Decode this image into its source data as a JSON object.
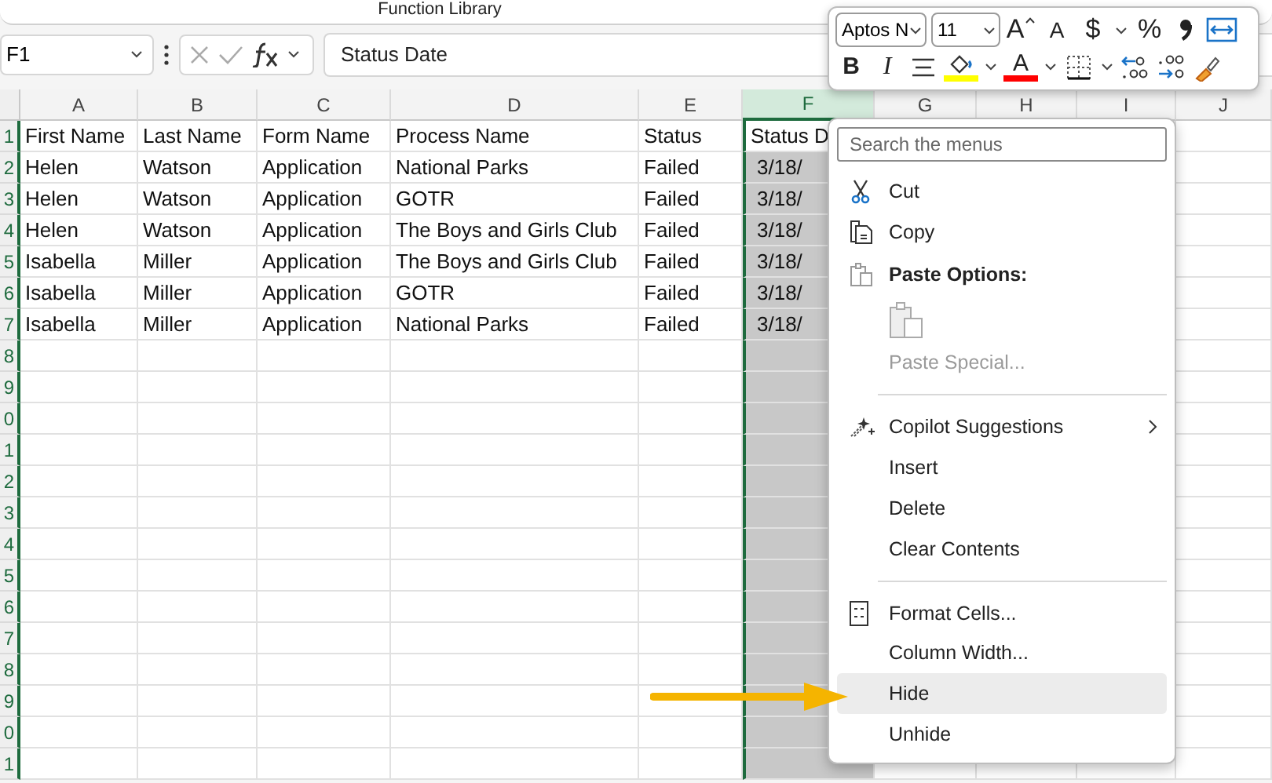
{
  "ribbon": {
    "group_label": "Function Library"
  },
  "formula_bar": {
    "name_box": "F1",
    "value": "Status Date"
  },
  "columns": [
    {
      "label": "A",
      "selected": false
    },
    {
      "label": "B",
      "selected": false
    },
    {
      "label": "C",
      "selected": false
    },
    {
      "label": "D",
      "selected": false
    },
    {
      "label": "E",
      "selected": false
    },
    {
      "label": "F",
      "selected": true
    },
    {
      "label": "G",
      "selected": false
    },
    {
      "label": "H",
      "selected": false
    },
    {
      "label": "I",
      "selected": false
    },
    {
      "label": "J",
      "selected": false
    }
  ],
  "rows": [
    {
      "number": "1",
      "cells": [
        "First Name",
        "Last Name",
        "Form Name",
        "Process Name",
        "Status",
        "Status D"
      ]
    },
    {
      "number": "2",
      "cells": [
        "Helen",
        "Watson",
        "Application",
        "National Parks",
        "Failed",
        "3/18/"
      ]
    },
    {
      "number": "3",
      "cells": [
        "Helen",
        "Watson",
        "Application",
        "GOTR",
        "Failed",
        "3/18/"
      ]
    },
    {
      "number": "4",
      "cells": [
        "Helen",
        "Watson",
        "Application",
        "The Boys and Girls Club",
        "Failed",
        "3/18/"
      ]
    },
    {
      "number": "5",
      "cells": [
        "Isabella",
        "Miller",
        "Application",
        "The Boys and Girls Club",
        "Failed",
        "3/18/"
      ]
    },
    {
      "number": "6",
      "cells": [
        "Isabella",
        "Miller",
        "Application",
        "GOTR",
        "Failed",
        "3/18/"
      ]
    },
    {
      "number": "7",
      "cells": [
        "Isabella",
        "Miller",
        "Application",
        "National Parks",
        "Failed",
        "3/18/"
      ]
    },
    {
      "number": "8"
    },
    {
      "number": "9"
    },
    {
      "number": "0"
    },
    {
      "number": "1"
    },
    {
      "number": "2"
    },
    {
      "number": "3"
    },
    {
      "number": "4"
    },
    {
      "number": "5"
    },
    {
      "number": "6"
    },
    {
      "number": "7"
    },
    {
      "number": "8"
    },
    {
      "number": "9"
    },
    {
      "number": "0"
    },
    {
      "number": "1"
    }
  ],
  "mini_toolbar": {
    "font": "Aptos N",
    "size": "11",
    "row_1": [
      {
        "kind": "grow",
        "text": "A"
      },
      {
        "kind": "shrink",
        "text": "A"
      },
      {
        "kind": "letter",
        "text": "$"
      },
      {
        "kind": "caret"
      },
      {
        "kind": "letter",
        "text": "%"
      },
      {
        "kind": "comma"
      },
      {
        "kind": "wrap"
      }
    ],
    "row_2": [
      {
        "kind": "bold",
        "text": "B"
      },
      {
        "kind": "italic",
        "text": "I"
      },
      {
        "kind": "align"
      },
      {
        "kind": "fill",
        "color": "#ffff00"
      },
      {
        "kind": "caret"
      },
      {
        "kind": "fontcolor",
        "text": "A",
        "color": "#ff0000"
      },
      {
        "kind": "caret"
      },
      {
        "kind": "borders"
      },
      {
        "kind": "caret"
      },
      {
        "kind": "decdec"
      },
      {
        "kind": "incdec"
      },
      {
        "kind": "painter"
      }
    ]
  },
  "context_menu": {
    "search_placeholder": "Search the menus",
    "items": [
      {
        "kind": "cut",
        "label": "Cut",
        "selected": false,
        "disabled": false
      },
      {
        "kind": "copy",
        "label": "Copy",
        "selected": false,
        "disabled": false
      },
      {
        "kind": "header",
        "label": "Paste Options:"
      },
      {
        "kind": "paste",
        "disabled": true
      },
      {
        "kind": "command",
        "label": "Paste Special...",
        "selected": false,
        "disabled": true
      },
      {
        "kind": "separator"
      },
      {
        "kind": "submenu",
        "label": "Copilot Suggestions",
        "selected": false,
        "disabled": false
      },
      {
        "kind": "command",
        "label": "Insert",
        "selected": false,
        "disabled": false
      },
      {
        "kind": "command",
        "label": "Delete",
        "selected": false,
        "disabled": false
      },
      {
        "kind": "command",
        "label": "Clear Contents",
        "selected": false,
        "disabled": false
      },
      {
        "kind": "separator"
      },
      {
        "kind": "format",
        "label": "Format Cells...",
        "selected": false,
        "disabled": false
      },
      {
        "kind": "command",
        "label": "Column Width...",
        "selected": false,
        "disabled": false
      },
      {
        "kind": "command",
        "label": "Hide",
        "selected": true,
        "disabled": false
      },
      {
        "kind": "command",
        "label": "Unhide",
        "selected": false,
        "disabled": false
      }
    ]
  }
}
